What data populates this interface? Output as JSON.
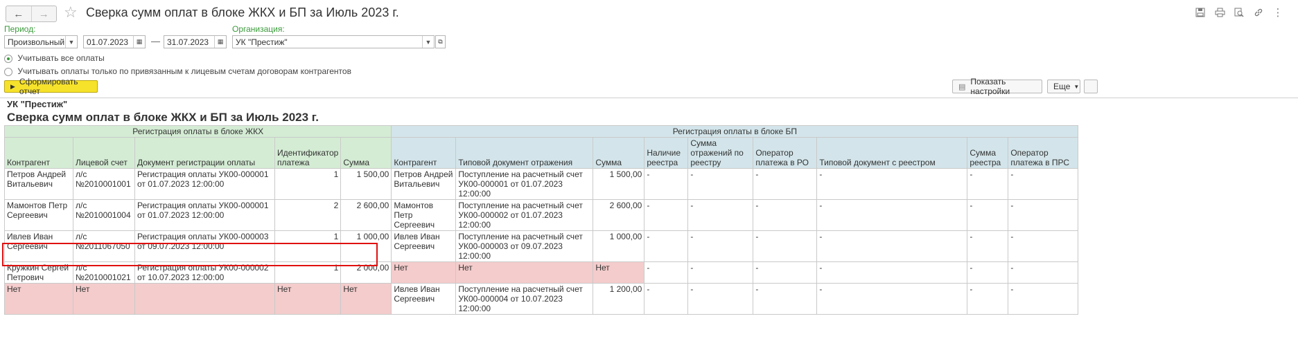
{
  "window": {
    "title": "Сверка сумм оплат в блоке ЖКХ и БП за Июль 2023 г."
  },
  "nav": {
    "back_icon": "arrow-left-icon",
    "forward_icon": "arrow-right-icon",
    "favorite_icon": "star-icon"
  },
  "toolbar_icons": [
    "save-icon",
    "print-icon",
    "preview-icon",
    "link-icon",
    "more-icon"
  ],
  "form": {
    "period_label": "Период:",
    "period_type": "Произвольный",
    "date_from": "01.07.2023",
    "dash": "—",
    "date_to": "31.07.2023",
    "org_label": "Организация:",
    "org_value": "УК \"Престиж\"",
    "radio1": "Учитывать все оплаты",
    "radio2": "Учитывать оплаты только по привязанным к лицевым счетам договорам контрагентов",
    "radio_selected": 1,
    "generate_btn": "Сформировать отчет",
    "settings_btn": "Показать настройки",
    "more_btn": "Еще"
  },
  "report": {
    "org": "УК \"Престиж\"",
    "title": "Сверка сумм оплат в блоке ЖКХ и БП за Июль 2023 г.",
    "group1": "Регистрация оплаты в блоке ЖКХ",
    "group2": "Регистрация оплаты в блоке БП",
    "headers": [
      "Контрагент",
      "Лицевой счет",
      "Документ регистрации оплаты",
      "Идентификатор платежа",
      "Сумма",
      "Контрагент",
      "Типовой документ отражения",
      "Сумма",
      "Наличие реестра",
      "Сумма отражений по реестру",
      "Оператор платежа в РО",
      "Типовой документ с реестром",
      "Сумма реестра",
      "Оператор платежа в ПРС"
    ],
    "rows": [
      [
        "Петров Андрей Витальевич",
        "л/с №2010001001",
        "Регистрация оплаты УК00-000001 от 01.07.2023 12:00:00",
        "1",
        "1 500,00",
        "Петров Андрей Витальевич",
        "Поступление на расчетный счет УК00-000001 от 01.07.2023 12:00:00",
        "1 500,00",
        "-",
        "-",
        "-",
        "-",
        "-",
        "-"
      ],
      [
        "Мамонтов Петр Сергеевич",
        "л/с №2010001004",
        "Регистрация оплаты УК00-000001 от 01.07.2023 12:00:00",
        "2",
        "2 600,00",
        "Мамонтов Петр Сергеевич",
        "Поступление на расчетный счет УК00-000002 от 01.07.2023 12:00:00",
        "2 600,00",
        "-",
        "-",
        "-",
        "-",
        "-",
        "-"
      ],
      [
        "Ивлев Иван Сергеевич",
        "л/с №2011067050",
        "Регистрация оплаты УК00-000003 от 09.07.2023 12:00:00",
        "1",
        "1 000,00",
        "Ивлев Иван Сергеевич",
        "Поступление на расчетный счет УК00-000003 от 09.07.2023 12:00:00",
        "1 000,00",
        "-",
        "-",
        "-",
        "-",
        "-",
        "-"
      ],
      [
        "Кружкин Сергей Петрович",
        "л/с №2010001021",
        "Регистрация оплаты УК00-000002 от 10.07.2023 12:00:00",
        "1",
        "2 000,00",
        "Нет",
        "Нет",
        "Нет",
        "-",
        "-",
        "-",
        "-",
        "-",
        "-"
      ],
      [
        "Нет",
        "Нет",
        "",
        "Нет",
        "Нет",
        "Ивлев Иван Сергеевич",
        "Поступление на расчетный счет УК00-000004 от 10.07.2023 12:00:00",
        "1 200,00",
        "-",
        "-",
        "-",
        "-",
        "-",
        "-"
      ]
    ],
    "pink_cells": [
      [
        3,
        5
      ],
      [
        3,
        6
      ],
      [
        3,
        7
      ],
      [
        4,
        0
      ],
      [
        4,
        1
      ],
      [
        4,
        2
      ],
      [
        4,
        3
      ],
      [
        4,
        4
      ]
    ],
    "colors": {
      "jkh_header": "#d4ecd4",
      "bp_header": "#d3e5ea",
      "missing": "#f4cccc",
      "highlight": "#e01010"
    }
  }
}
